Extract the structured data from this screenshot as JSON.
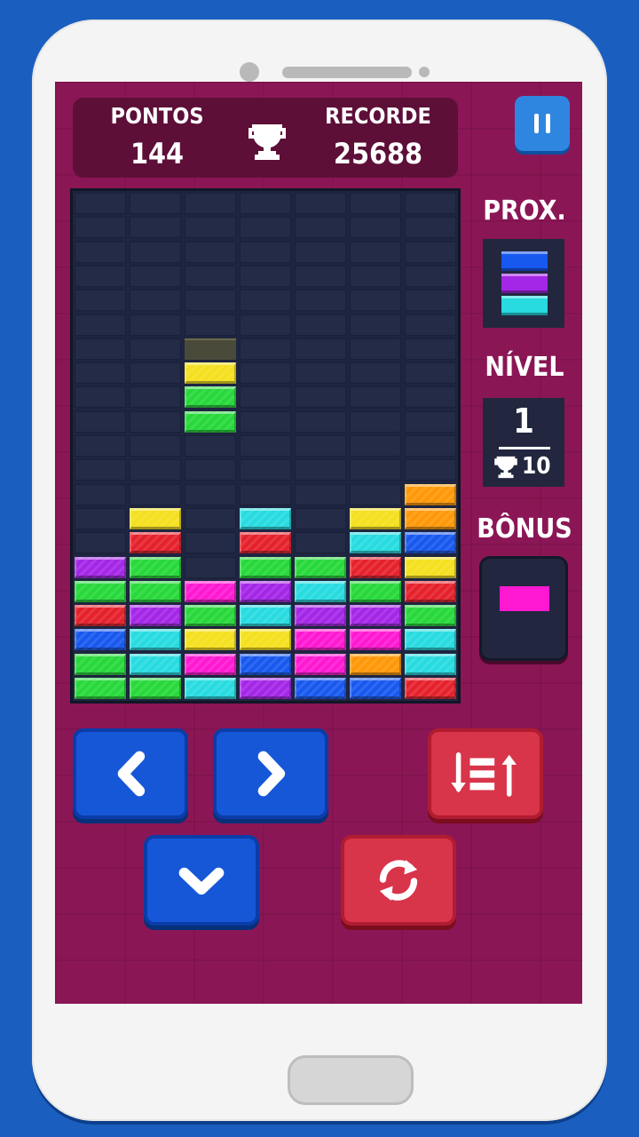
{
  "hud": {
    "score_label": "PONTOS",
    "score_value": "144",
    "record_label": "RECORDE",
    "record_value": "25688"
  },
  "side": {
    "next_label": "PROX.",
    "level_label": "NÍVEL",
    "level_value": "1",
    "level_target": "10",
    "bonus_label": "BÔNUS"
  },
  "colors": {
    "Y": "#f4e01e",
    "G": "#27d83a",
    "R": "#e5212c",
    "C": "#27dbe0",
    "B": "#1758ee",
    "P": "#a426e6",
    "M": "#ff18d2",
    "O": "#ff9808"
  },
  "board": {
    "rows": [
      ".......",
      ".......",
      ".......",
      ".......",
      ".......",
      ".......",
      ".......",
      "..Y....",
      "..G....",
      "..G....",
      ".......",
      ".......",
      "......O",
      ".Y.C.YO",
      ".R.R.CB",
      "PG.GGRY",
      "GGMPCGR",
      "RPGCPPG",
      "BCYYMMC",
      "GCMBMOC",
      "GGCPBBR"
    ],
    "ghost_row": 6,
    "ghost_col": 2
  },
  "next_piece": [
    "B",
    "P",
    "C"
  ],
  "bonus_piece": "M",
  "icons": {
    "pause": "pause-icon",
    "trophy": "trophy-icon",
    "left": "chevron-left-icon",
    "right": "chevron-right-icon",
    "down": "chevron-down-icon",
    "sort": "sort-icon",
    "rotate": "rotate-icon"
  }
}
